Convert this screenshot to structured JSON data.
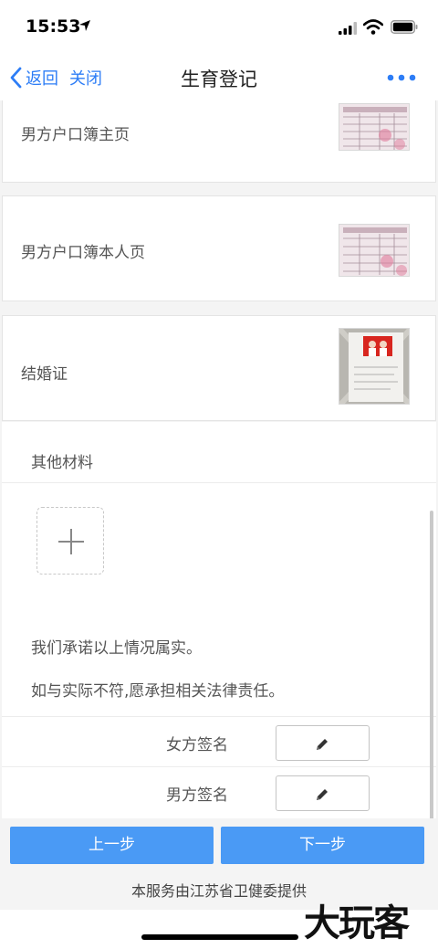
{
  "status_bar": {
    "time": "15:53"
  },
  "nav": {
    "back_label": "返回",
    "close_label": "关闭",
    "title": "生育登记"
  },
  "documents": [
    {
      "label": "男方户口簿主页",
      "thumbnail": "household-register-page-photo"
    },
    {
      "label": "男方户口簿本人页",
      "thumbnail": "household-register-page-photo"
    },
    {
      "label": "结婚证",
      "thumbnail": "marriage-certificate-photo"
    }
  ],
  "other_materials": {
    "title": "其他材料"
  },
  "promise": {
    "line1": "我们承诺以上情况属实。",
    "line2": "如与实际不符,愿承担相关法律责任。"
  },
  "signatures": [
    {
      "label": "女方签名"
    },
    {
      "label": "男方签名"
    }
  ],
  "footer": {
    "prev_label": "上一步",
    "next_label": "下一步",
    "provider": "本服务由江苏省卫健委提供"
  },
  "watermark": "大玩客",
  "colors": {
    "accent": "#2d7df6",
    "button": "#4a9af5",
    "background": "#f4f4f4"
  }
}
